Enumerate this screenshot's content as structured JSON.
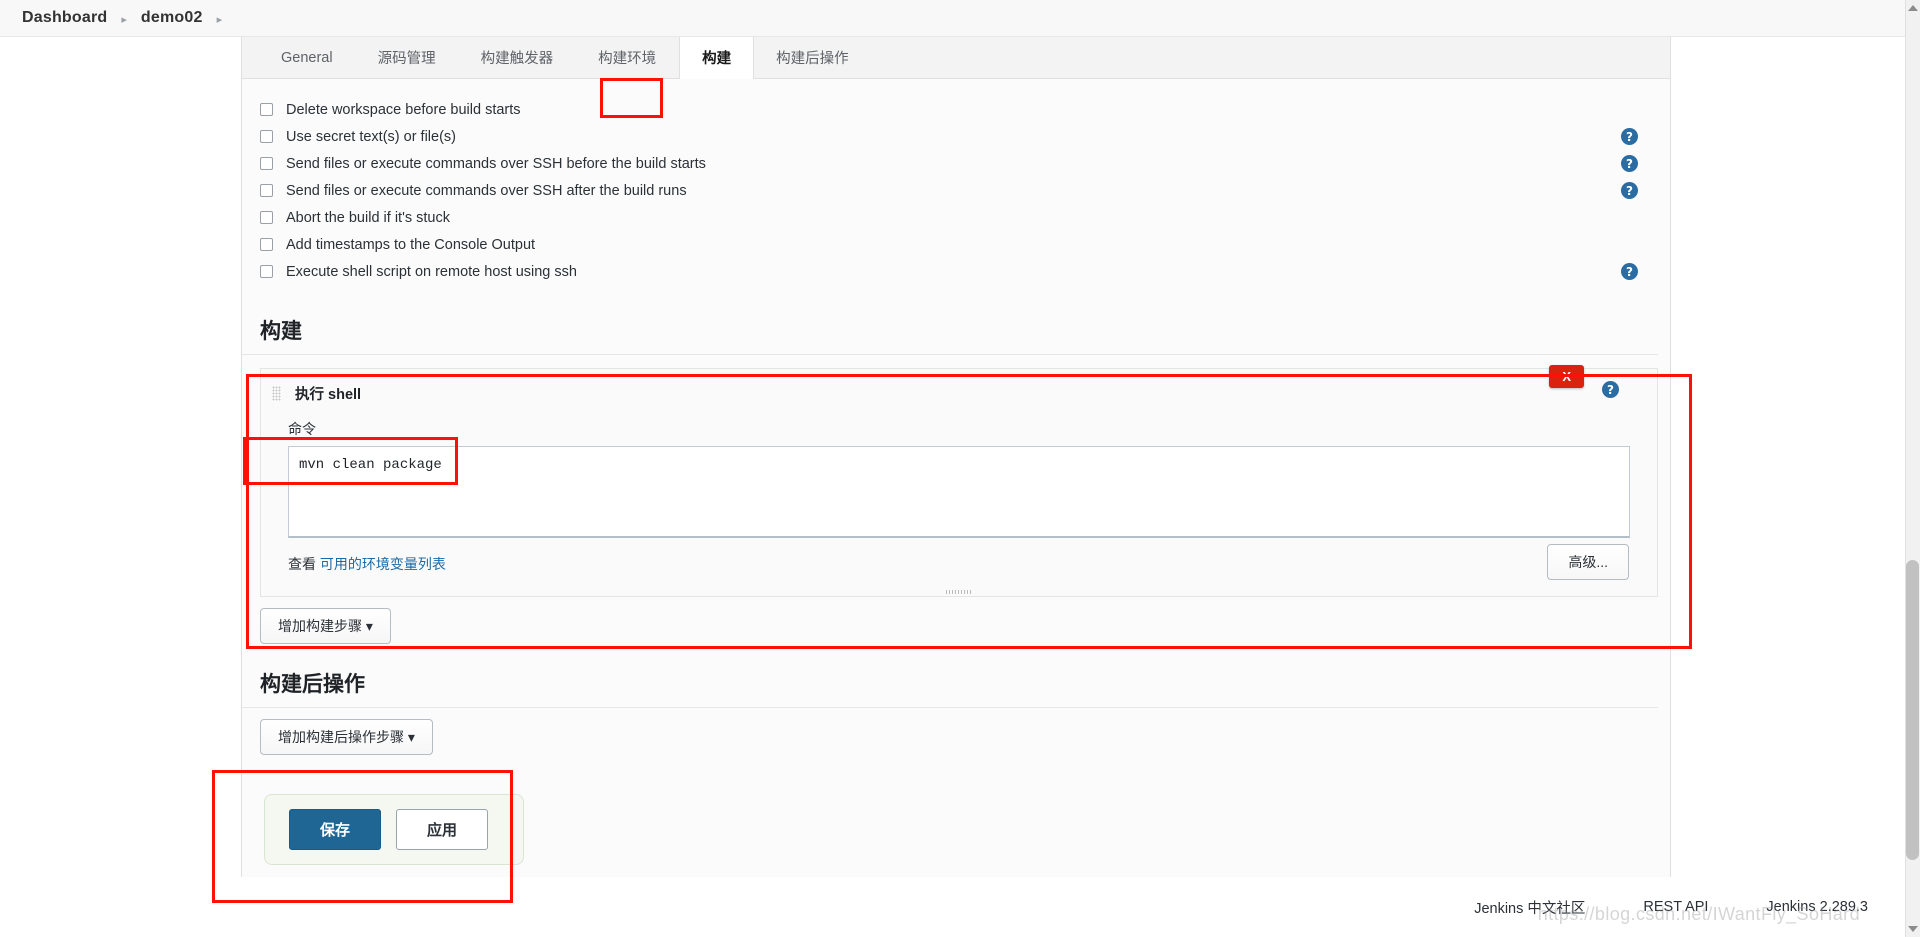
{
  "breadcrumb": {
    "items": [
      "Dashboard",
      "demo02"
    ],
    "separator": "▸"
  },
  "tabs": [
    {
      "label": "General",
      "active": false
    },
    {
      "label": "源码管理",
      "active": false
    },
    {
      "label": "构建触发器",
      "active": false
    },
    {
      "label": "构建环境",
      "active": false
    },
    {
      "label": "构建",
      "active": true
    },
    {
      "label": "构建后操作",
      "active": false
    }
  ],
  "build_environment": {
    "options": [
      {
        "label": "Delete workspace before build starts",
        "checked": false,
        "help": false
      },
      {
        "label": "Use secret text(s) or file(s)",
        "checked": false,
        "help": true
      },
      {
        "label": "Send files or execute commands over SSH before the build starts",
        "checked": false,
        "help": true
      },
      {
        "label": "Send files or execute commands over SSH after the build runs",
        "checked": false,
        "help": true
      },
      {
        "label": "Abort the build if it's stuck",
        "checked": false,
        "help": false
      },
      {
        "label": "Add timestamps to the Console Output",
        "checked": false,
        "help": false
      },
      {
        "label": "Execute shell script on remote host using ssh",
        "checked": false,
        "help": true
      }
    ]
  },
  "build_section": {
    "heading": "构建",
    "builder": {
      "title": "执行 shell",
      "delete_label": "X",
      "command_label": "命令",
      "command_value": "mvn clean package",
      "env_var_prefix": "查看",
      "env_var_link": "可用的环境变量列表",
      "advanced_label": "高级..."
    },
    "add_build_step_label": "增加构建步骤 ▾"
  },
  "post_build_section": {
    "heading": "构建后操作",
    "add_step_label": "增加构建后操作步骤 ▾"
  },
  "save_bar": {
    "save_label": "保存",
    "apply_label": "应用"
  },
  "footer": {
    "community_link": "Jenkins 中文社区",
    "rest_api_link": "REST API",
    "version": "Jenkins 2.289.3",
    "watermark": "https://blog.csdn.net/IWantFly_SoHard"
  },
  "icons": {
    "help": "?"
  },
  "colors": {
    "accent": "#2b6ca3",
    "danger": "#d9230f",
    "annotation": "#fc1106",
    "save_button": "#1f6695"
  }
}
